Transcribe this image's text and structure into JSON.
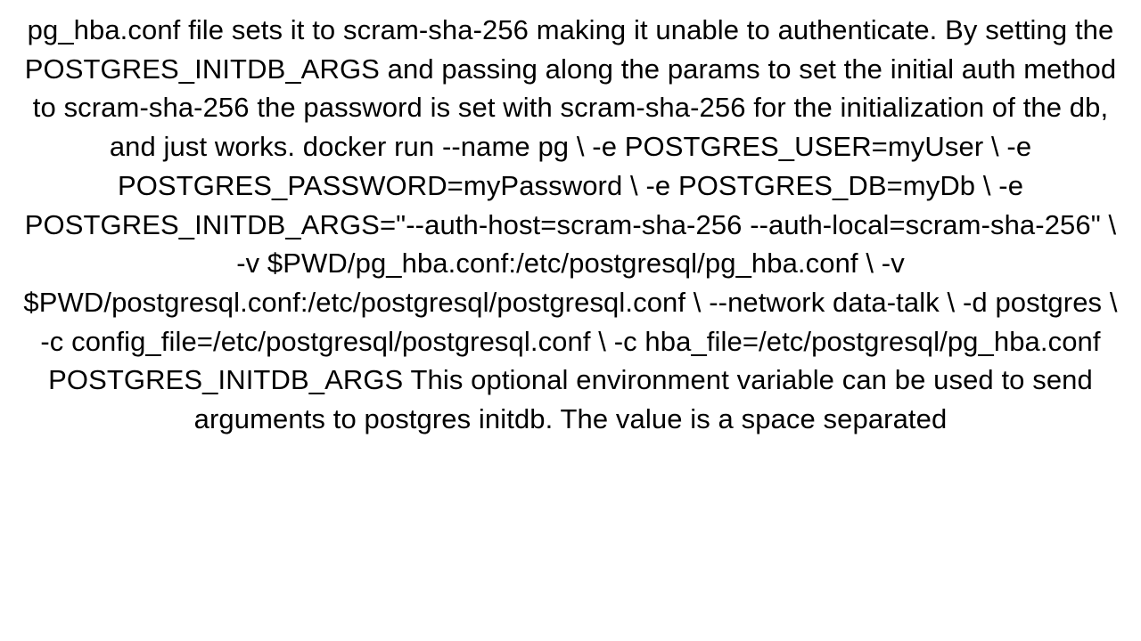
{
  "document": {
    "text": "pg_hba.conf file sets it to scram-sha-256 making it unable to authenticate.  By setting the POSTGRES_INITDB_ARGS and passing along the params to set the initial auth method to scram-sha-256 the password is set with scram-sha-256 for the initialization of the db, and just works. docker run --name pg \\ -e POSTGRES_USER=myUser \\ -e POSTGRES_PASSWORD=myPassword \\ -e POSTGRES_DB=myDb \\ -e POSTGRES_INITDB_ARGS=\"--auth-host=scram-sha-256 --auth-local=scram-sha-256\" \\ -v $PWD/pg_hba.conf:/etc/postgresql/pg_hba.conf \\ -v $PWD/postgresql.conf:/etc/postgresql/postgresql.conf \\ --network data-talk \\ -d postgres \\ -c config_file=/etc/postgresql/postgresql.conf \\ -c hba_file=/etc/postgresql/pg_hba.conf  POSTGRES_INITDB_ARGS This optional environment variable can be used to send arguments to postgres initdb. The value is a space separated"
  }
}
